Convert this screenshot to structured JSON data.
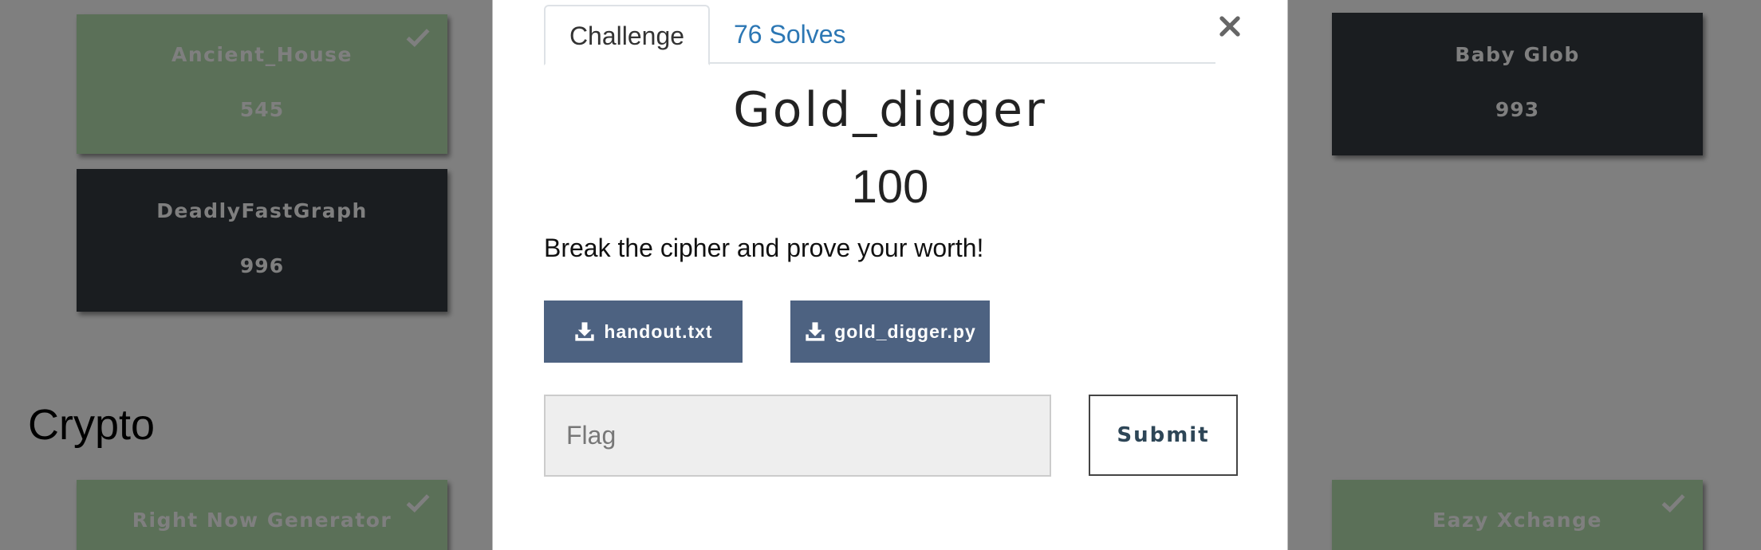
{
  "background": {
    "cards": [
      {
        "name": "Ancient_House",
        "value": "545",
        "solved": true
      },
      {
        "name": "DeadlyFastGraph",
        "value": "996",
        "solved": false
      },
      {
        "name": "Baby Glob",
        "value": "993",
        "solved": false
      },
      {
        "name": "Right Now Generator",
        "value": "",
        "solved": true
      },
      {
        "name": "Eazy Xchange",
        "value": "",
        "solved": true
      }
    ],
    "category": "Crypto"
  },
  "modal": {
    "tabs": [
      {
        "label": "Challenge",
        "active": true
      },
      {
        "label": "76 Solves",
        "active": false
      }
    ],
    "close_icon": "close-icon",
    "challenge": {
      "name": "Gold_digger",
      "value": "100",
      "description": "Break the cipher and prove your worth!"
    },
    "files": [
      {
        "label": "handout.txt",
        "icon": "download-icon"
      },
      {
        "label": "gold_digger.py",
        "icon": "download-icon"
      }
    ],
    "flag_input": {
      "placeholder": "Flag",
      "value": ""
    },
    "submit_label": "Submit"
  },
  "colors": {
    "solved_card": "#b6e0b0",
    "unsolved_card": "#343a40",
    "file_button": "#4d6281",
    "tab_link": "#2c77b4",
    "overlay": "rgba(0,0,0,0.5)"
  }
}
